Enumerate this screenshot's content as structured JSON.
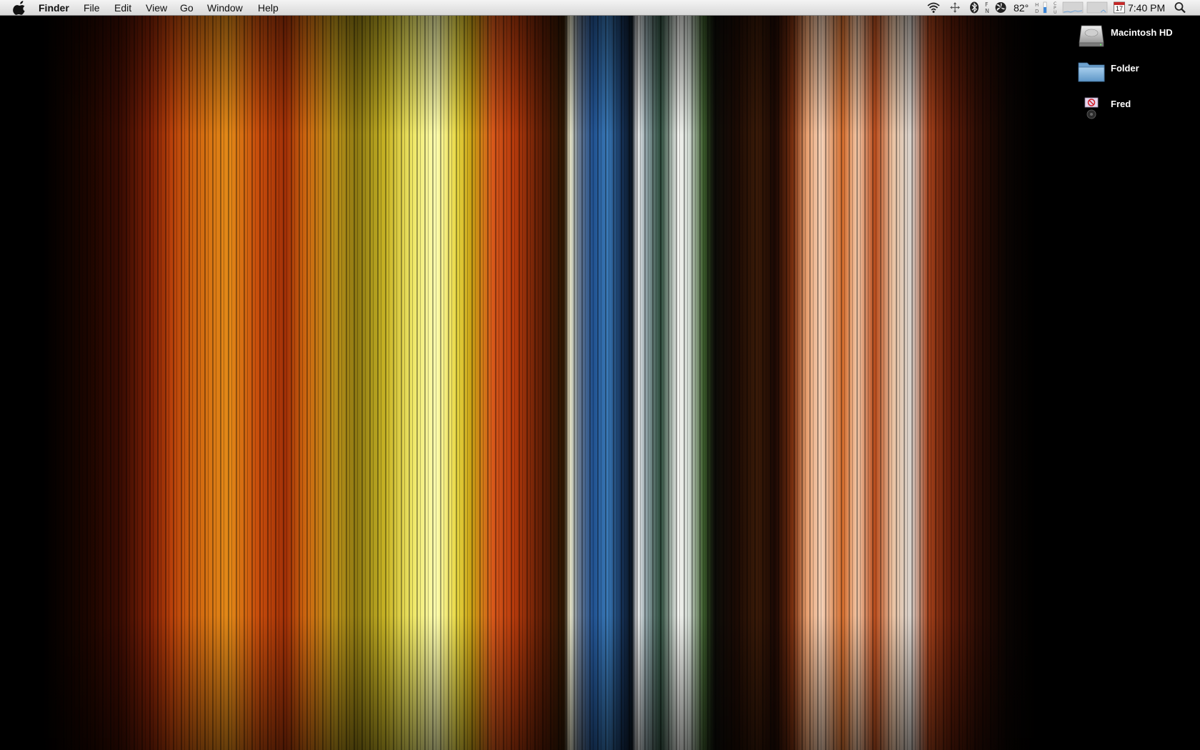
{
  "menubar": {
    "app_name": "Finder",
    "items": [
      "File",
      "Edit",
      "View",
      "Go",
      "Window",
      "Help"
    ],
    "status": {
      "temperature": "82°",
      "calendar_day": "17",
      "clock": "7:40 PM"
    },
    "icons": [
      "apple-icon",
      "wifi-icon",
      "network-activity-icon",
      "bluetooth-icon",
      "fan-icon",
      "hdd-meter-icon",
      "cpu-meter-icon",
      "calendar-icon",
      "spotlight-search-icon"
    ]
  },
  "desktop": {
    "icons": [
      {
        "label": "Macintosh HD",
        "icon": "hard-drive-icon"
      },
      {
        "label": "Folder",
        "icon": "folder-icon"
      },
      {
        "label": "Fred",
        "icon": "blocked-user-icon"
      }
    ]
  },
  "colors": {
    "menubar_bg": "#e6e6e6",
    "desktop_bg": "#000000",
    "folder_blue": "#7fb1d8"
  }
}
